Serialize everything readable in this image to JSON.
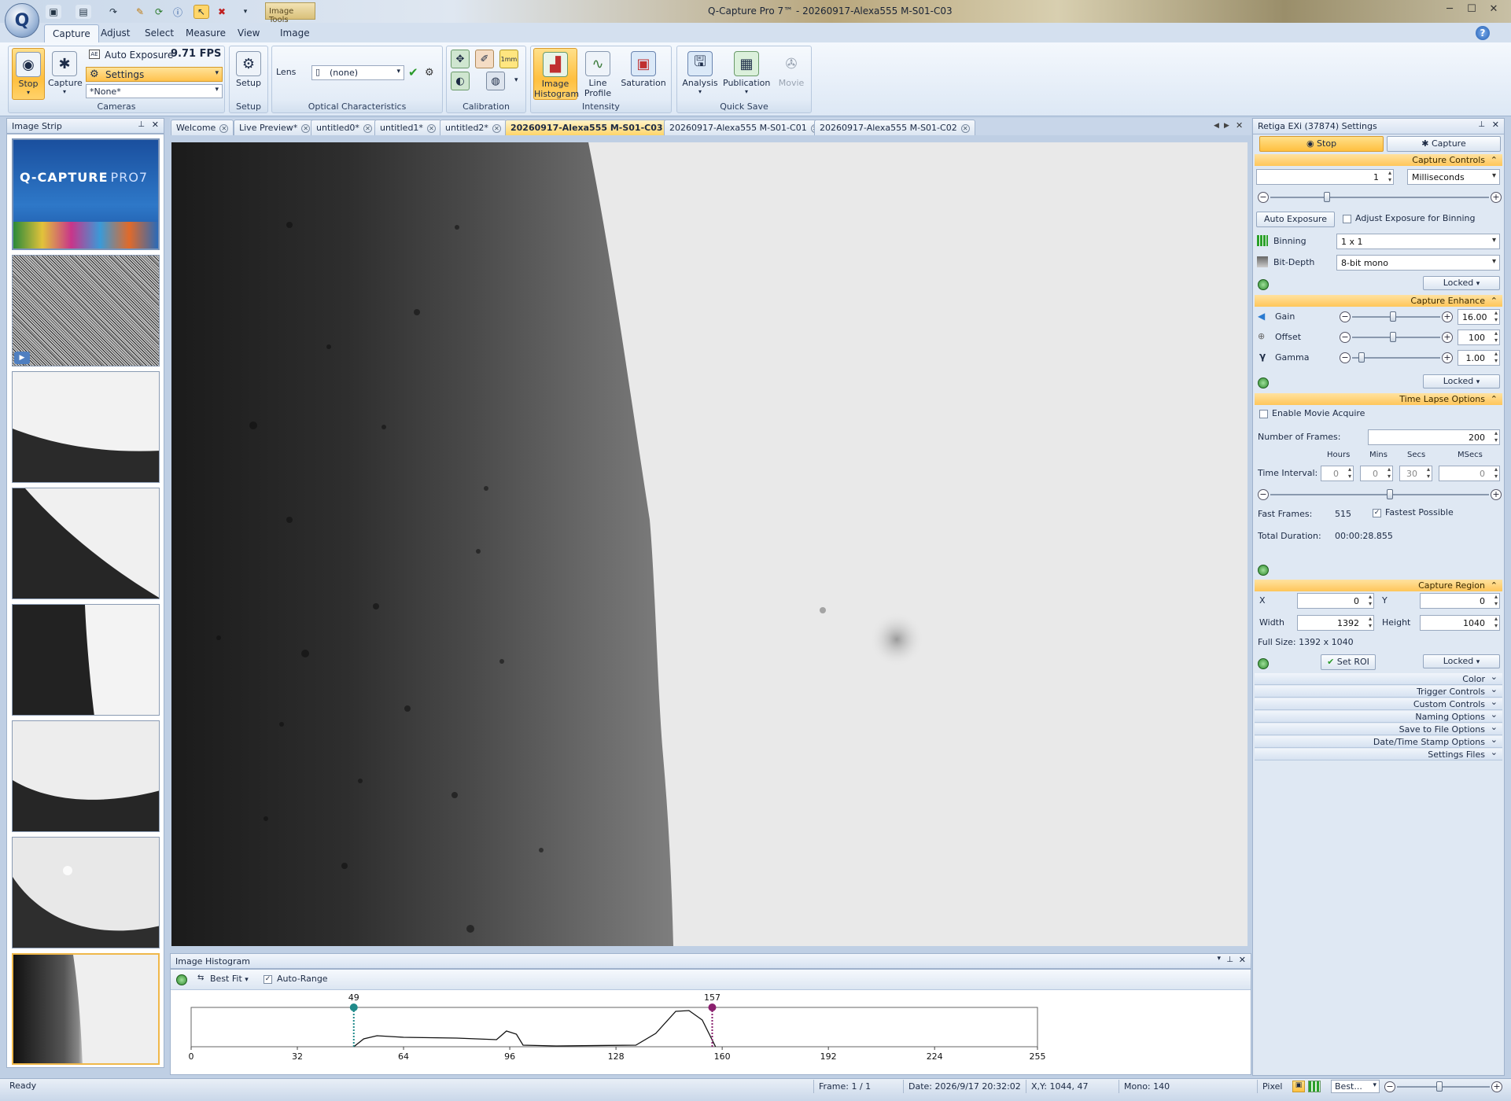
{
  "window": {
    "title": "Q-Capture Pro 7™ - 20260917-Alexa555 M-S01-C03",
    "contextual_tab": "Image Tools",
    "controls": [
      "minimize",
      "maximize",
      "close"
    ]
  },
  "ribbon": {
    "tabs": [
      "Capture",
      "Adjust",
      "Select",
      "Measure",
      "View",
      "Image"
    ],
    "active_tab": "Capture",
    "cameras": {
      "stop_label": "Stop",
      "capture_label": "Capture",
      "auto_exposure_label": "Auto Exposure",
      "fps": "9.71 FPS",
      "settings_label": "Settings",
      "preset_value": "*None*",
      "group_label": "Cameras"
    },
    "setup": {
      "button_label": "Setup",
      "group_label": "Setup"
    },
    "optical": {
      "lens_label": "Lens",
      "lens_value": "(none)",
      "group_label": "Optical Characteristics"
    },
    "calibration": {
      "group_label": "Calibration"
    },
    "intensity": {
      "histogram_label": "Image Histogram",
      "line_profile_label": "Line Profile",
      "saturation_label": "Saturation",
      "group_label": "Intensity"
    },
    "quick_save": {
      "analysis_label": "Analysis",
      "publication_label": "Publication",
      "movie_label": "Movie",
      "group_label": "Quick Save"
    }
  },
  "image_strip": {
    "title": "Image Strip",
    "splash_title": "Q-CAPTURE",
    "splash_suffix": "PRO7",
    "thumbnail_count": 8
  },
  "doc_tabs": [
    {
      "label": "Welcome",
      "active": false
    },
    {
      "label": "Live Preview*",
      "active": false
    },
    {
      "label": "untitled0*",
      "active": false
    },
    {
      "label": "untitled1*",
      "active": false
    },
    {
      "label": "untitled2*",
      "active": false
    },
    {
      "label": "20260917-Alexa555 M-S01-C03",
      "active": true
    },
    {
      "label": "20260917-Alexa555 M-S01-C01",
      "active": false
    },
    {
      "label": "20260917-Alexa555 M-S01-C02",
      "active": false
    }
  ],
  "histogram": {
    "title": "Image Histogram",
    "fit_label": "Best Fit",
    "auto_range_label": "Auto-Range",
    "auto_range_checked": true,
    "low_marker": "49",
    "high_marker": "157",
    "ticks": [
      "0",
      "32",
      "64",
      "96",
      "128",
      "160",
      "192",
      "224",
      "255"
    ],
    "x_range": [
      0,
      255
    ],
    "low_marker_color": "#1f8a8a",
    "high_marker_color": "#8a1f6e"
  },
  "settings_panel": {
    "title": "Retiga EXi (37874) Settings",
    "stop_tab": "Stop",
    "capture_tab": "Capture",
    "capture_controls": {
      "header": "Capture Controls",
      "exposure_value": "1",
      "exposure_unit": "Milliseconds",
      "auto_exposure_button": "Auto Exposure",
      "adjust_binning_label": "Adjust Exposure for Binning",
      "binning_label": "Binning",
      "binning_value": "1 x 1",
      "bit_depth_label": "Bit-Depth",
      "bit_depth_value": "8-bit mono",
      "locked_label": "Locked"
    },
    "capture_enhance": {
      "header": "Capture Enhance",
      "gain_label": "Gain",
      "gain_value": "16.00",
      "offset_label": "Offset",
      "offset_value": "100",
      "gamma_label": "Gamma",
      "gamma_value": "1.00",
      "locked_label": "Locked"
    },
    "time_lapse": {
      "header": "Time Lapse Options",
      "enable_movie_label": "Enable Movie Acquire",
      "frames_label": "Number of Frames:",
      "frames_value": "200",
      "col_hours": "Hours",
      "col_mins": "Mins",
      "col_secs": "Secs",
      "col_msecs": "MSecs",
      "interval_label": "Time Interval:",
      "hours_value": "0",
      "mins_value": "0",
      "secs_value": "30",
      "msecs_value": "0",
      "fast_frames_label": "Fast Frames:",
      "fast_frames_value": "515",
      "fastest_label": "Fastest Possible",
      "total_duration_label": "Total Duration:",
      "total_duration_value": "00:00:28.855"
    },
    "capture_region": {
      "header": "Capture Region",
      "x_label": "X",
      "x_value": "0",
      "y_label": "Y",
      "y_value": "0",
      "width_label": "Width",
      "width_value": "1392",
      "height_label": "Height",
      "height_value": "1040",
      "full_size": "Full Size: 1392 x 1040",
      "set_roi_label": "Set ROI",
      "locked_label": "Locked"
    },
    "collapsed_sections": [
      "Color",
      "Trigger Controls",
      "Custom Controls",
      "Naming Options",
      "Save to File Options",
      "Date/Time Stamp Options",
      "Settings Files"
    ]
  },
  "status_bar": {
    "ready": "Ready",
    "frame": "Frame: 1 / 1",
    "date": "Date: 2026/9/17 20:32:02",
    "xy": "X,Y: 1044,   47",
    "mono": "Mono:   140",
    "pixel": "Pixel",
    "zoom_mode": "Best..."
  }
}
